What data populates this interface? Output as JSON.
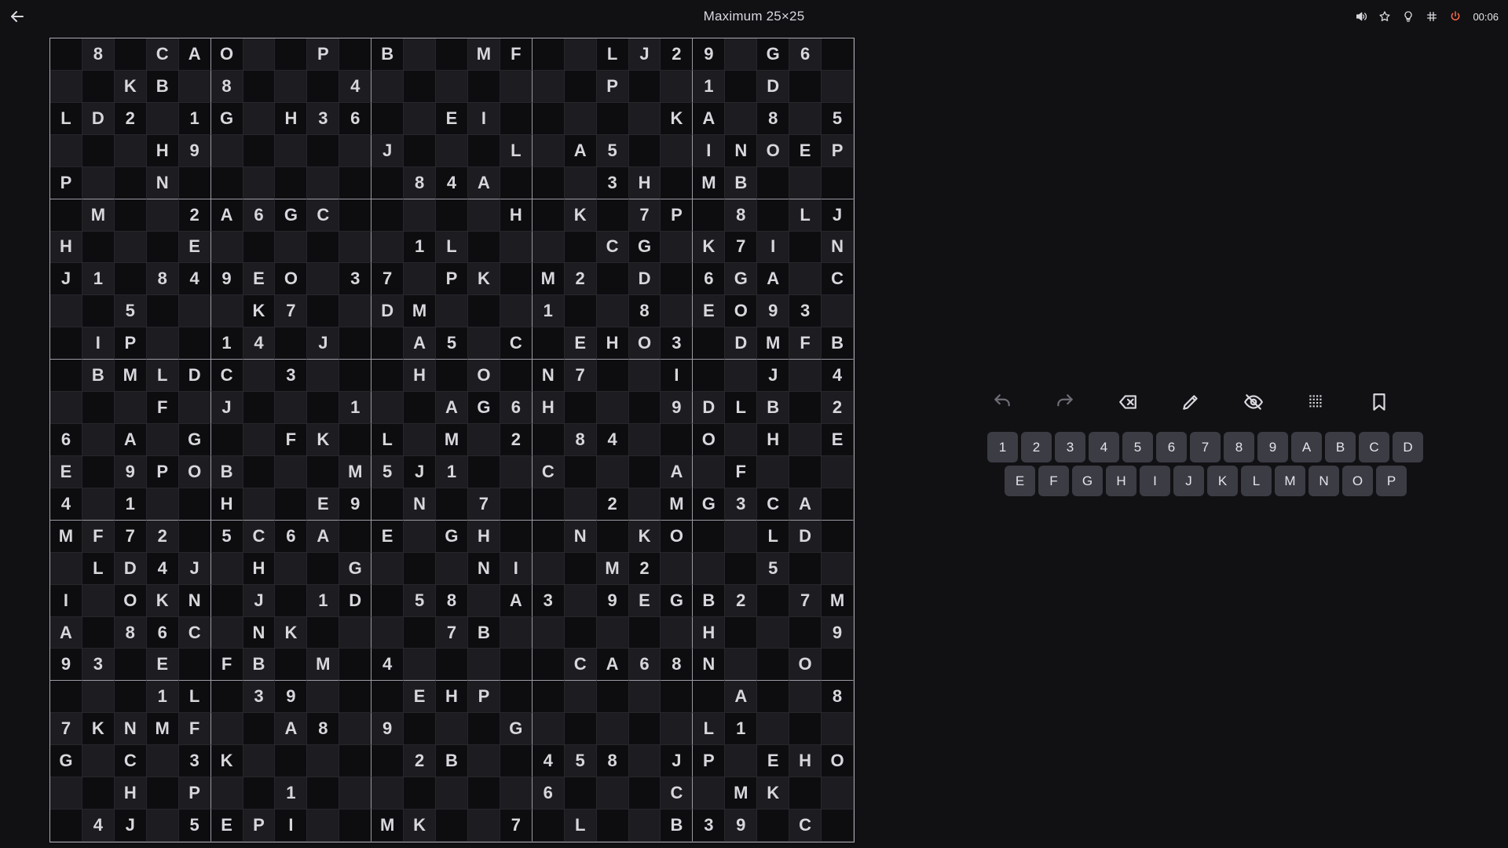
{
  "header": {
    "title": "Maximum 25×25",
    "timer": "00:06",
    "icons": [
      "back-icon",
      "sound-icon",
      "star-icon",
      "hint-lightbulb-icon",
      "grid-hash-icon",
      "power-icon"
    ]
  },
  "board": {
    "size": 25,
    "box_size": 5,
    "rows": [
      [
        "",
        "8",
        "",
        "C",
        "A",
        "O",
        "",
        "",
        "P",
        "",
        "B",
        "",
        "",
        "M",
        "F",
        "",
        "",
        "L",
        "J",
        "2",
        "9",
        "",
        "G",
        "6",
        ""
      ],
      [
        "",
        "",
        "K",
        "B",
        "",
        "8",
        "",
        "",
        "",
        "4",
        "",
        "",
        "",
        "",
        "",
        "",
        "",
        "P",
        "",
        "",
        "1",
        "",
        "D",
        "",
        ""
      ],
      [
        "L",
        "D",
        "2",
        "",
        "1",
        "G",
        "",
        "H",
        "3",
        "6",
        "",
        "",
        "E",
        "I",
        "",
        "",
        "",
        "",
        "",
        "K",
        "A",
        "",
        "8",
        "",
        "5"
      ],
      [
        "",
        "",
        "",
        "H",
        "9",
        "",
        "",
        "",
        "",
        "",
        "J",
        "",
        "",
        "",
        "L",
        "",
        "A",
        "5",
        "",
        "",
        "I",
        "N",
        "O",
        "E",
        "P"
      ],
      [
        "P",
        "",
        "",
        "N",
        "",
        "",
        "",
        "",
        "",
        "",
        "",
        "8",
        "4",
        "A",
        "",
        "",
        "",
        "3",
        "H",
        "",
        "M",
        "B",
        "",
        "",
        ""
      ],
      [
        "",
        "M",
        "",
        "",
        "2",
        "A",
        "6",
        "G",
        "C",
        "",
        "",
        "",
        "",
        "",
        "H",
        "",
        "K",
        "",
        "7",
        "P",
        "",
        "8",
        "",
        "L",
        "J"
      ],
      [
        "H",
        "",
        "",
        "",
        "E",
        "",
        "",
        "",
        "",
        "",
        "",
        "1",
        "L",
        "",
        "",
        "",
        "",
        "C",
        "G",
        "",
        "K",
        "7",
        "I",
        "",
        "N"
      ],
      [
        "J",
        "1",
        "",
        "8",
        "4",
        "9",
        "E",
        "O",
        "",
        "3",
        "7",
        "",
        "P",
        "K",
        "",
        "M",
        "2",
        "",
        "D",
        "",
        "6",
        "G",
        "A",
        "",
        "C"
      ],
      [
        "",
        "",
        "5",
        "",
        "",
        "",
        "K",
        "7",
        "",
        "",
        "D",
        "M",
        "",
        "",
        "",
        "1",
        "",
        "",
        "8",
        "",
        "E",
        "O",
        "9",
        "3",
        ""
      ],
      [
        "",
        "I",
        "P",
        "",
        "",
        "1",
        "4",
        "",
        "J",
        "",
        "",
        "A",
        "5",
        "",
        "C",
        "",
        "E",
        "H",
        "O",
        "3",
        "",
        "D",
        "M",
        "F",
        "B"
      ],
      [
        "",
        "B",
        "M",
        "L",
        "D",
        "C",
        "",
        "3",
        "",
        "",
        "",
        "H",
        "",
        "O",
        "",
        "N",
        "7",
        "",
        "",
        "I",
        "",
        "",
        "J",
        "",
        "4"
      ],
      [
        "",
        "",
        "",
        "F",
        "",
        "J",
        "",
        "",
        "",
        "1",
        "",
        "",
        "A",
        "G",
        "6",
        "H",
        "",
        "",
        "",
        "9",
        "D",
        "L",
        "B",
        "",
        "2"
      ],
      [
        "6",
        "",
        "A",
        "",
        "G",
        "",
        "",
        "F",
        "K",
        "",
        "L",
        "",
        "M",
        "",
        "2",
        "",
        "8",
        "4",
        "",
        "",
        "O",
        "",
        "H",
        "",
        "E"
      ],
      [
        "E",
        "",
        "9",
        "P",
        "O",
        "B",
        "",
        "",
        "",
        "M",
        "5",
        "J",
        "1",
        "",
        "",
        "C",
        "",
        "",
        "",
        "A",
        "",
        "F",
        "",
        "",
        ""
      ],
      [
        "4",
        "",
        "1",
        "",
        "",
        "H",
        "",
        "",
        "E",
        "9",
        "",
        "N",
        "",
        "7",
        "",
        "",
        "",
        "2",
        "",
        "M",
        "G",
        "3",
        "C",
        "A",
        ""
      ],
      [
        "M",
        "F",
        "7",
        "2",
        "",
        "5",
        "C",
        "6",
        "A",
        "",
        "E",
        "",
        "G",
        "H",
        "",
        "",
        "N",
        "",
        "K",
        "O",
        "",
        "",
        "L",
        "D",
        ""
      ],
      [
        "",
        "L",
        "D",
        "4",
        "J",
        "",
        "H",
        "",
        "",
        "G",
        "",
        "",
        "",
        "N",
        "I",
        "",
        "",
        "M",
        "2",
        "",
        "",
        "",
        "5",
        "",
        ""
      ],
      [
        "I",
        "",
        "O",
        "K",
        "N",
        "",
        "J",
        "",
        "1",
        "D",
        "",
        "5",
        "8",
        "",
        "A",
        "3",
        "",
        "9",
        "E",
        "G",
        "B",
        "2",
        "",
        "7",
        "M"
      ],
      [
        "A",
        "",
        "8",
        "6",
        "C",
        "",
        "N",
        "K",
        "",
        "",
        "",
        "",
        "7",
        "B",
        "",
        "",
        "",
        "",
        "",
        "",
        "H",
        "",
        "",
        "",
        "9"
      ],
      [
        "9",
        "3",
        "",
        "E",
        "",
        "F",
        "B",
        "",
        "M",
        "",
        "4",
        "",
        "",
        "",
        "",
        "",
        "C",
        "A",
        "6",
        "8",
        "N",
        "",
        "",
        "O",
        ""
      ],
      [
        "",
        "",
        "",
        "1",
        "L",
        "",
        "3",
        "9",
        "",
        "",
        "",
        "E",
        "H",
        "P",
        "",
        "",
        "",
        "",
        "",
        "",
        "",
        "A",
        "",
        "",
        "8"
      ],
      [
        "7",
        "K",
        "N",
        "M",
        "F",
        "",
        "",
        "A",
        "8",
        "",
        "9",
        "",
        "",
        "",
        "G",
        "",
        "",
        "",
        "",
        "",
        "L",
        "1",
        "",
        "",
        ""
      ],
      [
        "G",
        "",
        "C",
        "",
        "3",
        "K",
        "",
        "",
        "",
        "",
        "",
        "2",
        "B",
        "",
        "",
        "4",
        "5",
        "8",
        "",
        "J",
        "P",
        "",
        "E",
        "H",
        "O"
      ],
      [
        "",
        "",
        "H",
        "",
        "P",
        "",
        "",
        "1",
        "",
        "",
        "",
        "",
        "",
        "",
        "",
        "6",
        "",
        "",
        "",
        "C",
        "",
        "M",
        "K",
        "",
        ""
      ],
      [
        "",
        "4",
        "J",
        "",
        "5",
        "E",
        "P",
        "I",
        "",
        "",
        "M",
        "K",
        "",
        "",
        "7",
        "",
        "L",
        "",
        "",
        "B",
        "3",
        "9",
        "",
        "C",
        ""
      ]
    ]
  },
  "toolbar": {
    "tools": [
      {
        "name": "undo-icon"
      },
      {
        "name": "redo-icon"
      },
      {
        "name": "erase-icon"
      },
      {
        "name": "pencil-icon"
      },
      {
        "name": "hide-eye-icon"
      },
      {
        "name": "dotted-grid-icon"
      },
      {
        "name": "bookmark-icon"
      }
    ]
  },
  "keypad": {
    "row1": [
      "1",
      "2",
      "3",
      "4",
      "5",
      "6",
      "7",
      "8",
      "9",
      "A",
      "B",
      "C",
      "D"
    ],
    "row2": [
      "E",
      "F",
      "G",
      "H",
      "I",
      "J",
      "K",
      "L",
      "M",
      "N",
      "O",
      "P"
    ]
  },
  "colors": {
    "background": "#111114",
    "cell_dark": "#0d0d10",
    "cell_light": "#1c1c21",
    "key_bg": "#3b3c44",
    "text": "#d7d7dc"
  }
}
